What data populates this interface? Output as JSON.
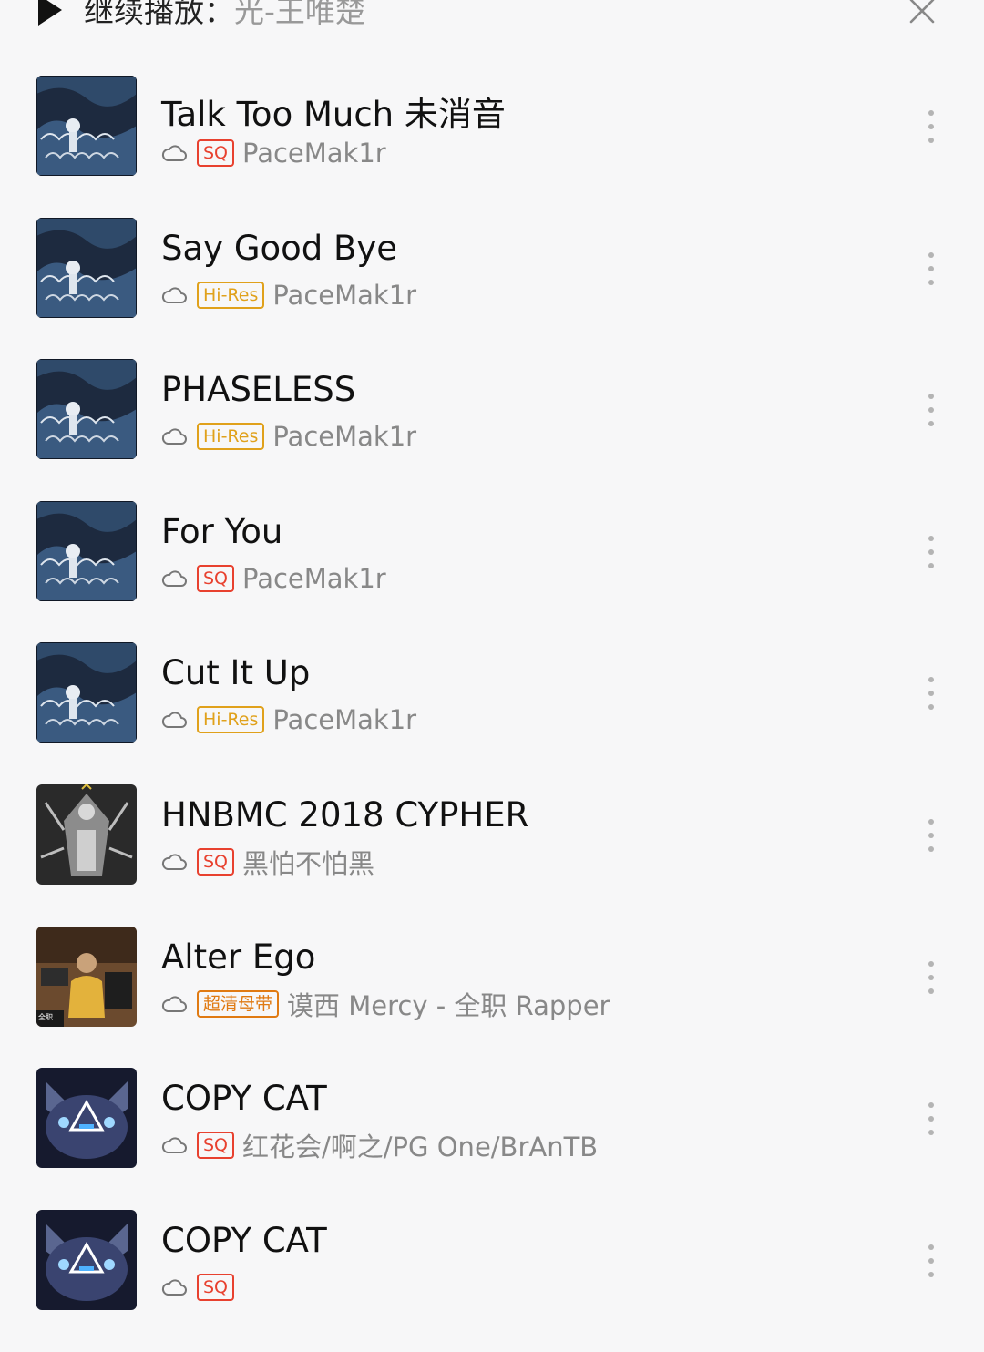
{
  "header": {
    "label": "继续播放：",
    "source": "光-王唯楚"
  },
  "songs": [
    {
      "title": "Talk Too Much 未消音",
      "quality": "SQ",
      "artist": "PaceMak1r",
      "cover": "dark-blue-waves"
    },
    {
      "title": "Say Good Bye",
      "quality": "Hi-Res",
      "artist": "PaceMak1r",
      "cover": "dark-blue-waves"
    },
    {
      "title": "PHASELESS",
      "quality": "Hi-Res",
      "artist": "PaceMak1r",
      "cover": "dark-blue-waves"
    },
    {
      "title": "For You",
      "quality": "SQ",
      "artist": "PaceMak1r",
      "cover": "dark-blue-waves"
    },
    {
      "title": "Cut It Up",
      "quality": "Hi-Res",
      "artist": "PaceMak1r",
      "cover": "dark-blue-waves"
    },
    {
      "title": "HNBMC 2018 CYPHER",
      "quality": "SQ",
      "artist": "黑怕不怕黑",
      "cover": "gothic-statue"
    },
    {
      "title": "Alter Ego",
      "quality": "超清母带",
      "artist": "谟西 Mercy - 全职 Rapper",
      "cover": "studio-photo"
    },
    {
      "title": "COPY CAT",
      "quality": "SQ",
      "artist": "红花会/啊之/PG One/BrAnTB",
      "cover": "cat-triangle"
    },
    {
      "title": "COPY CAT",
      "quality": "SQ",
      "artist": "",
      "cover": "cat-triangle"
    }
  ],
  "colors": {
    "sq": "#e8412f",
    "hires": "#e0a11b",
    "master": "#e07a12"
  }
}
